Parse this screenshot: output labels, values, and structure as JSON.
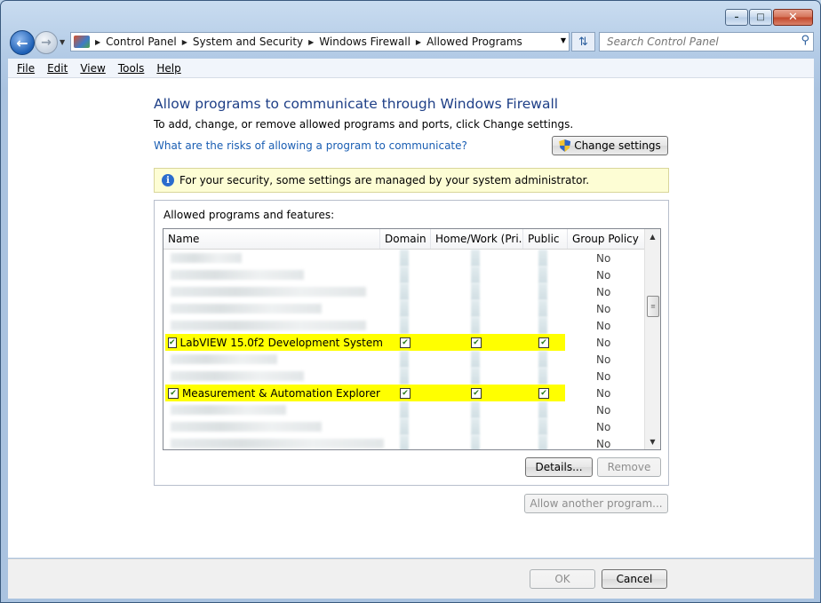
{
  "window": {
    "caption_buttons": [
      "minimize",
      "maximize",
      "close"
    ]
  },
  "address": {
    "crumbs": [
      "Control Panel",
      "System and Security",
      "Windows Firewall",
      "Allowed Programs"
    ]
  },
  "search": {
    "placeholder": "Search Control Panel"
  },
  "menu": [
    "File",
    "Edit",
    "View",
    "Tools",
    "Help"
  ],
  "page": {
    "title": "Allow programs to communicate through Windows Firewall",
    "subtitle": "To add, change, or remove allowed programs and ports, click Change settings.",
    "risk_link": "What are the risks of allowing a program to communicate?",
    "change_settings": "Change settings",
    "info_text": "For your security, some settings are managed by your system administrator.",
    "group_label": "Allowed programs and features:"
  },
  "table": {
    "columns": [
      "Name",
      "Domain",
      "Home/Work (Pri...",
      "Public",
      "Group Policy"
    ],
    "rows": [
      {
        "name": "",
        "blurred": true,
        "group_policy": "No"
      },
      {
        "name": "",
        "blurred": true,
        "group_policy": "No"
      },
      {
        "name": "",
        "blurred": true,
        "group_policy": "No"
      },
      {
        "name": "",
        "blurred": true,
        "group_policy": "No"
      },
      {
        "name": "",
        "blurred": true,
        "group_policy": "No"
      },
      {
        "name": "LabVIEW 15.0f2 Development System",
        "blurred": false,
        "highlighted": true,
        "checked": true,
        "domain": true,
        "home": true,
        "public": true,
        "group_policy": "No"
      },
      {
        "name": "",
        "blurred": true,
        "group_policy": "No"
      },
      {
        "name": "",
        "blurred": true,
        "group_policy": "No"
      },
      {
        "name": "Measurement & Automation Explorer",
        "blurred": false,
        "highlighted": true,
        "checked": true,
        "domain": true,
        "home": true,
        "public": true,
        "group_policy": "No"
      },
      {
        "name": "",
        "blurred": true,
        "group_policy": "No"
      },
      {
        "name": "",
        "blurred": true,
        "group_policy": "No"
      },
      {
        "name": "",
        "blurred": true,
        "group_policy": "No"
      }
    ]
  },
  "buttons": {
    "details": "Details...",
    "remove": "Remove",
    "allow_another": "Allow another program...",
    "ok": "OK",
    "cancel": "Cancel"
  },
  "colors": {
    "title": "#1e3f87",
    "link": "#1a5eb3",
    "highlight": "#ffff00",
    "info_bg": "#fdfdd4"
  }
}
